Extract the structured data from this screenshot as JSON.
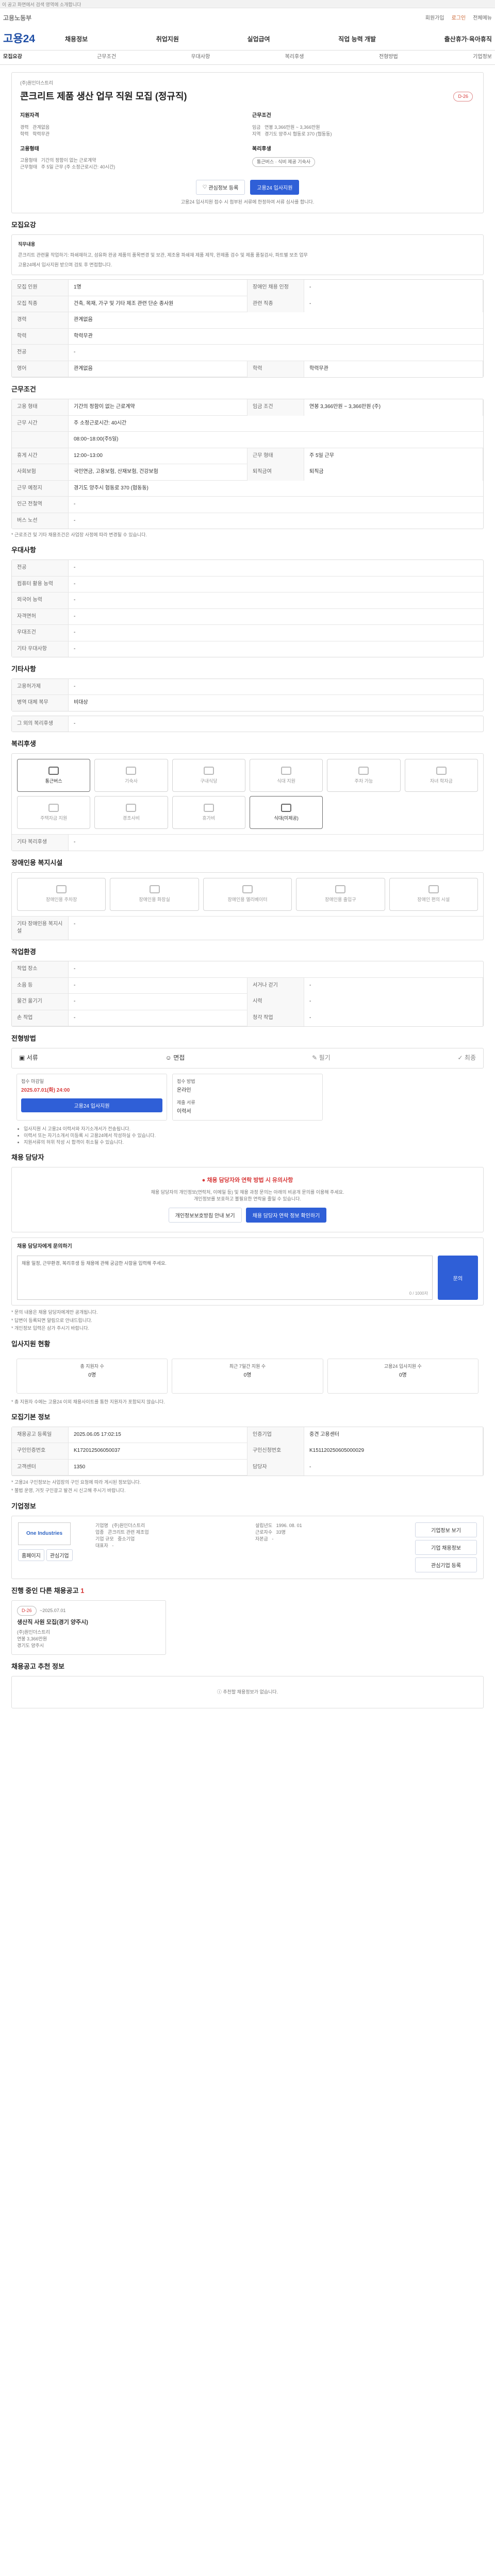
{
  "topbar": {
    "text": "이 공고 화면에서 검색 영역에 소개합니다"
  },
  "header": {
    "logo": "고용노동부",
    "utilities": [
      "회원가입",
      "로그인",
      "전체메뉴"
    ],
    "brand": "고용24",
    "gnb": [
      "채용정보",
      "취업지원",
      "실업급여",
      "직업 능력 개발",
      "출산휴가·육아휴직"
    ],
    "subnav": [
      "모집요강",
      "근무조건",
      "우대사항",
      "복리후생",
      "전형방법",
      "기업정보"
    ]
  },
  "job": {
    "company": "(주)원인더스트리",
    "title": "콘크리트 제품 생산 업무 직원 모집 (정규직)",
    "dday": "D-26",
    "summary": [
      {
        "label": "지원자격",
        "value": ""
      },
      {
        "label": "경력",
        "value": "관계없음"
      },
      {
        "label": "학력",
        "value": "학력무관"
      },
      {
        "label": "고용형태",
        "value": ""
      },
      {
        "label": "고용형태",
        "value": "기간의 정함이 없는 근로계약"
      },
      {
        "label": "근무형태",
        "value": "주 5일 근무 (주 소정근로시간: 40시간)"
      }
    ],
    "conditions": [
      {
        "label": "근무조건",
        "value": ""
      },
      {
        "label": "임금",
        "value": "연봉 3,366만원 ~ 3,366만원"
      },
      {
        "label": "지역",
        "value": "경기도 양주시 협동로 370 (협동동)"
      },
      {
        "label": "복리후생",
        "value": "통근버스 · 식비 제공 기숙사"
      }
    ],
    "actions": {
      "save": "관심정보 등록",
      "apply": "고용24 입사지원"
    },
    "note": "고용24 입사지원 접수 시 첨부된 서류에 한정하여 서류 심사를 합니다."
  },
  "recruit": {
    "title": "모집요강",
    "duty_title": "직무내용",
    "duty_lines": [
      "콘크리트 관련물 작업하기: 파쇄재하고, 섬유화 완공 제품의 품목변경 및 보관, 제조용 파쇄재 제품 제작, 완제품 검수 및 제품 품질검사, 파트별 보조 업무",
      "고용24에서 입사지원 받으며 검토 후 면접합니다."
    ],
    "table": [
      {
        "k": "모집 인원",
        "v": "1명",
        "k2": "장애인 채용 인정",
        "v2": "-"
      },
      {
        "k": "모집 직종",
        "v": "건축, 목재, 가구 및 기타 제조 관련 단순 종사원",
        "k2": "관련 직종",
        "v2": "-"
      },
      {
        "k": "경력",
        "v": "관계없음",
        "k2": "",
        "v2": ""
      },
      {
        "k": "학력",
        "v": "학력무관",
        "k2": "",
        "v2": ""
      },
      {
        "k": "전공",
        "v": "-",
        "k2": "",
        "v2": ""
      },
      {
        "k": "영어",
        "v": "관계없음",
        "k2": "학력",
        "v2": "학력무관"
      }
    ]
  },
  "work": {
    "title": "근무조건",
    "rows": [
      {
        "k": "고용 형태",
        "v": "기간의 정함이 없는 근로계약",
        "k2": "임금 조건",
        "v2": "연봉 3,366만원 ~ 3,366만원 (주)"
      },
      {
        "k": "근무 시간",
        "v": "주 소정근로시간: 40시간",
        "k2": "",
        "v2": ""
      },
      {
        "k": "",
        "v": "08:00~18:00(주5일)",
        "k2": "",
        "v2": ""
      },
      {
        "k": "휴게 시간",
        "v": "12:00~13:00",
        "k2": "근무 형태",
        "v2": "주 5일 근무"
      },
      {
        "k": "사회보험",
        "v": "국민연금, 고용보험, 산재보험, 건강보험",
        "k2": "퇴직금여",
        "v2": "퇴직금"
      },
      {
        "k": "근무 예정지",
        "v": "경기도 양주시 협동로 370 (협동동)",
        "k2": "",
        "v2": ""
      },
      {
        "k": "인근 전철역",
        "v": "-",
        "k2": "",
        "v2": ""
      },
      {
        "k": "버스 노선",
        "v": "-",
        "k2": "",
        "v2": ""
      }
    ],
    "note": "* 근로조건 및 기타 채용조건은 사업장 사정에 따라 변경될 수 있습니다."
  },
  "prefer": {
    "title": "우대사항",
    "rows": [
      {
        "k": "전공",
        "v": "-"
      },
      {
        "k": "컴퓨터 활용 능력",
        "v": "-"
      },
      {
        "k": "외국어 능력",
        "v": "-"
      },
      {
        "k": "자격면허",
        "v": "-"
      },
      {
        "k": "우대조건",
        "v": "-"
      },
      {
        "k": "기타 우대사항",
        "v": "-"
      }
    ]
  },
  "other": {
    "title": "기타사항",
    "rows": [
      {
        "k": "고용허가제",
        "v": "-"
      },
      {
        "k": "병역 대체 복무",
        "v": "비대상"
      }
    ],
    "extra_title": "그 외의 복리후생",
    "extra_value": "-"
  },
  "welfare": {
    "title": "복리후생",
    "tiles": [
      {
        "label": "통근버스",
        "active": true
      },
      {
        "label": "기숙사",
        "active": false
      },
      {
        "label": "구내식당",
        "active": false
      },
      {
        "label": "식대 지원",
        "active": false
      },
      {
        "label": "주차 가능",
        "active": false
      },
      {
        "label": "자녀 학자금",
        "active": false
      },
      {
        "label": "주택자금 지원",
        "active": false
      },
      {
        "label": "경조사비",
        "active": false
      },
      {
        "label": "휴가비",
        "active": false
      },
      {
        "label": "식대(미제공)",
        "active": true
      },
      {
        "label": "",
        "active": false
      },
      {
        "label": "",
        "active": false
      }
    ],
    "footer": "기타 복리후생",
    "footer_value": "-"
  },
  "disabled": {
    "title": "장애인용 복지시설",
    "tiles": [
      "장애인용 주차장",
      "장애인용 화장실",
      "장애인용 엘리베이터",
      "장애인용 출입구",
      "장애인 편의 시설"
    ],
    "footer": "기타 장애인용 복지시설",
    "footer_value": "-"
  },
  "environment": {
    "title": "작업환경",
    "rows": [
      {
        "k": "작업 장소",
        "v": "-",
        "k2": "",
        "v2": ""
      },
      {
        "k": "소음 등",
        "v": "-",
        "k2": "서거나 걷기",
        "v2": "-"
      },
      {
        "k": "물건 옮기기",
        "v": "-",
        "k2": "시력",
        "v2": "-"
      },
      {
        "k": "손 작업",
        "v": "-",
        "k2": "청각 작업",
        "v2": "-"
      }
    ]
  },
  "selection": {
    "title": "전형방법",
    "steps": [
      "서류",
      "면접",
      "필기",
      "최종"
    ],
    "apply_title": "접수 마감일",
    "apply_date": "2025.07.01(화) 24:00",
    "apply_method": "접수 방법",
    "apply_method_value": "온라인",
    "apply_doc": "제출 서류",
    "apply_doc_value": "이력서",
    "btn": "고용24 입사지원",
    "notes": [
      "입사지원 시 고용24 이력서와 자기소개서가 전송됩니다.",
      "이력서 또는 자기소개서 미등록 시 고용24에서 작성하실 수 있습니다.",
      "지원서류의 허위 작성 시 합격이 취소될 수 있습니다."
    ]
  },
  "contact": {
    "title": "채용 담당자",
    "warning_title": "채용 담당자와 연락 방법 시 유의사항",
    "warning_lines": [
      "채용 담당자의 개인정보(연락처, 이메일 등) 및 채용 과정 문의는 아래의 비공개 문의를 이용해 주세요.",
      "개인정보를 보호하고 불필요한 연락을 줄일 수 있습니다."
    ],
    "btn1": "개인정보보호방침 안내 보기",
    "btn2": "채용 담당자 연락 정보 확인하기",
    "question_title": "채용 담당자에게 문의하기",
    "question_placeholder": "채용 일정, 근무환경, 복리후생 등 채용에 관해 궁금한 사항을 입력해 주세요.",
    "question_count": "0 / 1000자",
    "question_btn": "문의",
    "notes": [
      "* 문의 내용은 채용 담당자에게만 공개됩니다.",
      "* 답변이 등록되면 알림으로 안내드립니다.",
      "* 개인정보 입력은 삼가 주시기 바랍니다."
    ]
  },
  "status": {
    "title": "입사지원 현황",
    "items": [
      {
        "label": "총 지원자 수",
        "value": "0명"
      },
      {
        "label": "최근 7일간 지원 수",
        "value": "0명"
      },
      {
        "label": "고용24 입사지원 수",
        "value": "0명"
      }
    ],
    "note": "* 총 지원자 수에는 고용24 이외 채용사이트를 통한 지원자가 포함되지 않습니다."
  },
  "info": {
    "title": "모집기본 정보",
    "rows": [
      {
        "k": "채용공고 등록일",
        "v": "2025.06.05 17:02:15",
        "k2": "인증기업",
        "v2": "중견 고용센터"
      },
      {
        "k": "구인인증번호",
        "v": "K172012506050037",
        "k2": "구인신청번호",
        "v2": "K151120250605000029"
      },
      {
        "k": "고객센터",
        "v": "1350",
        "k2": "담당자",
        "v2": "-"
      }
    ],
    "notes": [
      "* 고용24 구인정보는 사업장의 구인 요청에 따라 게시된 정보입니다.",
      "* 불법 운영, 거짓 구인광고 발견 시 신고해 주시기 바랍니다."
    ]
  },
  "company": {
    "title": "기업정보",
    "logo": "One Industries",
    "homepage": "홈페이지",
    "follow": "관심기업",
    "rows": [
      {
        "k": "기업명",
        "v": "(주)원인더스트리"
      },
      {
        "k": "업종",
        "v": "콘크리트 관련 제조업"
      },
      {
        "k": "기업 규모",
        "v": "중소기업"
      },
      {
        "k": "대표자",
        "v": "-"
      }
    ],
    "right": [
      {
        "k": "설립년도",
        "v": "1996. 08. 01"
      },
      {
        "k": "근로자수",
        "v": "33명"
      },
      {
        "k": "자본금",
        "v": "-"
      }
    ],
    "btns": [
      "기업정보 보기",
      "기업 채용정보",
      "관심기업 등록"
    ]
  },
  "more": {
    "title": "진행 중인 다른 채용공고",
    "count": "1",
    "card": {
      "dday": "D-26",
      "title": "생산직 사원 모집(경기 양주시)",
      "company": "(주)원인더스트리",
      "salary": "연봉 3,366만원",
      "place": "경기도 양주시",
      "date": "~2025.07.01"
    }
  },
  "recommend": {
    "title": "채용공고 추천 정보",
    "empty": "추천할 채용정보가 없습니다."
  }
}
